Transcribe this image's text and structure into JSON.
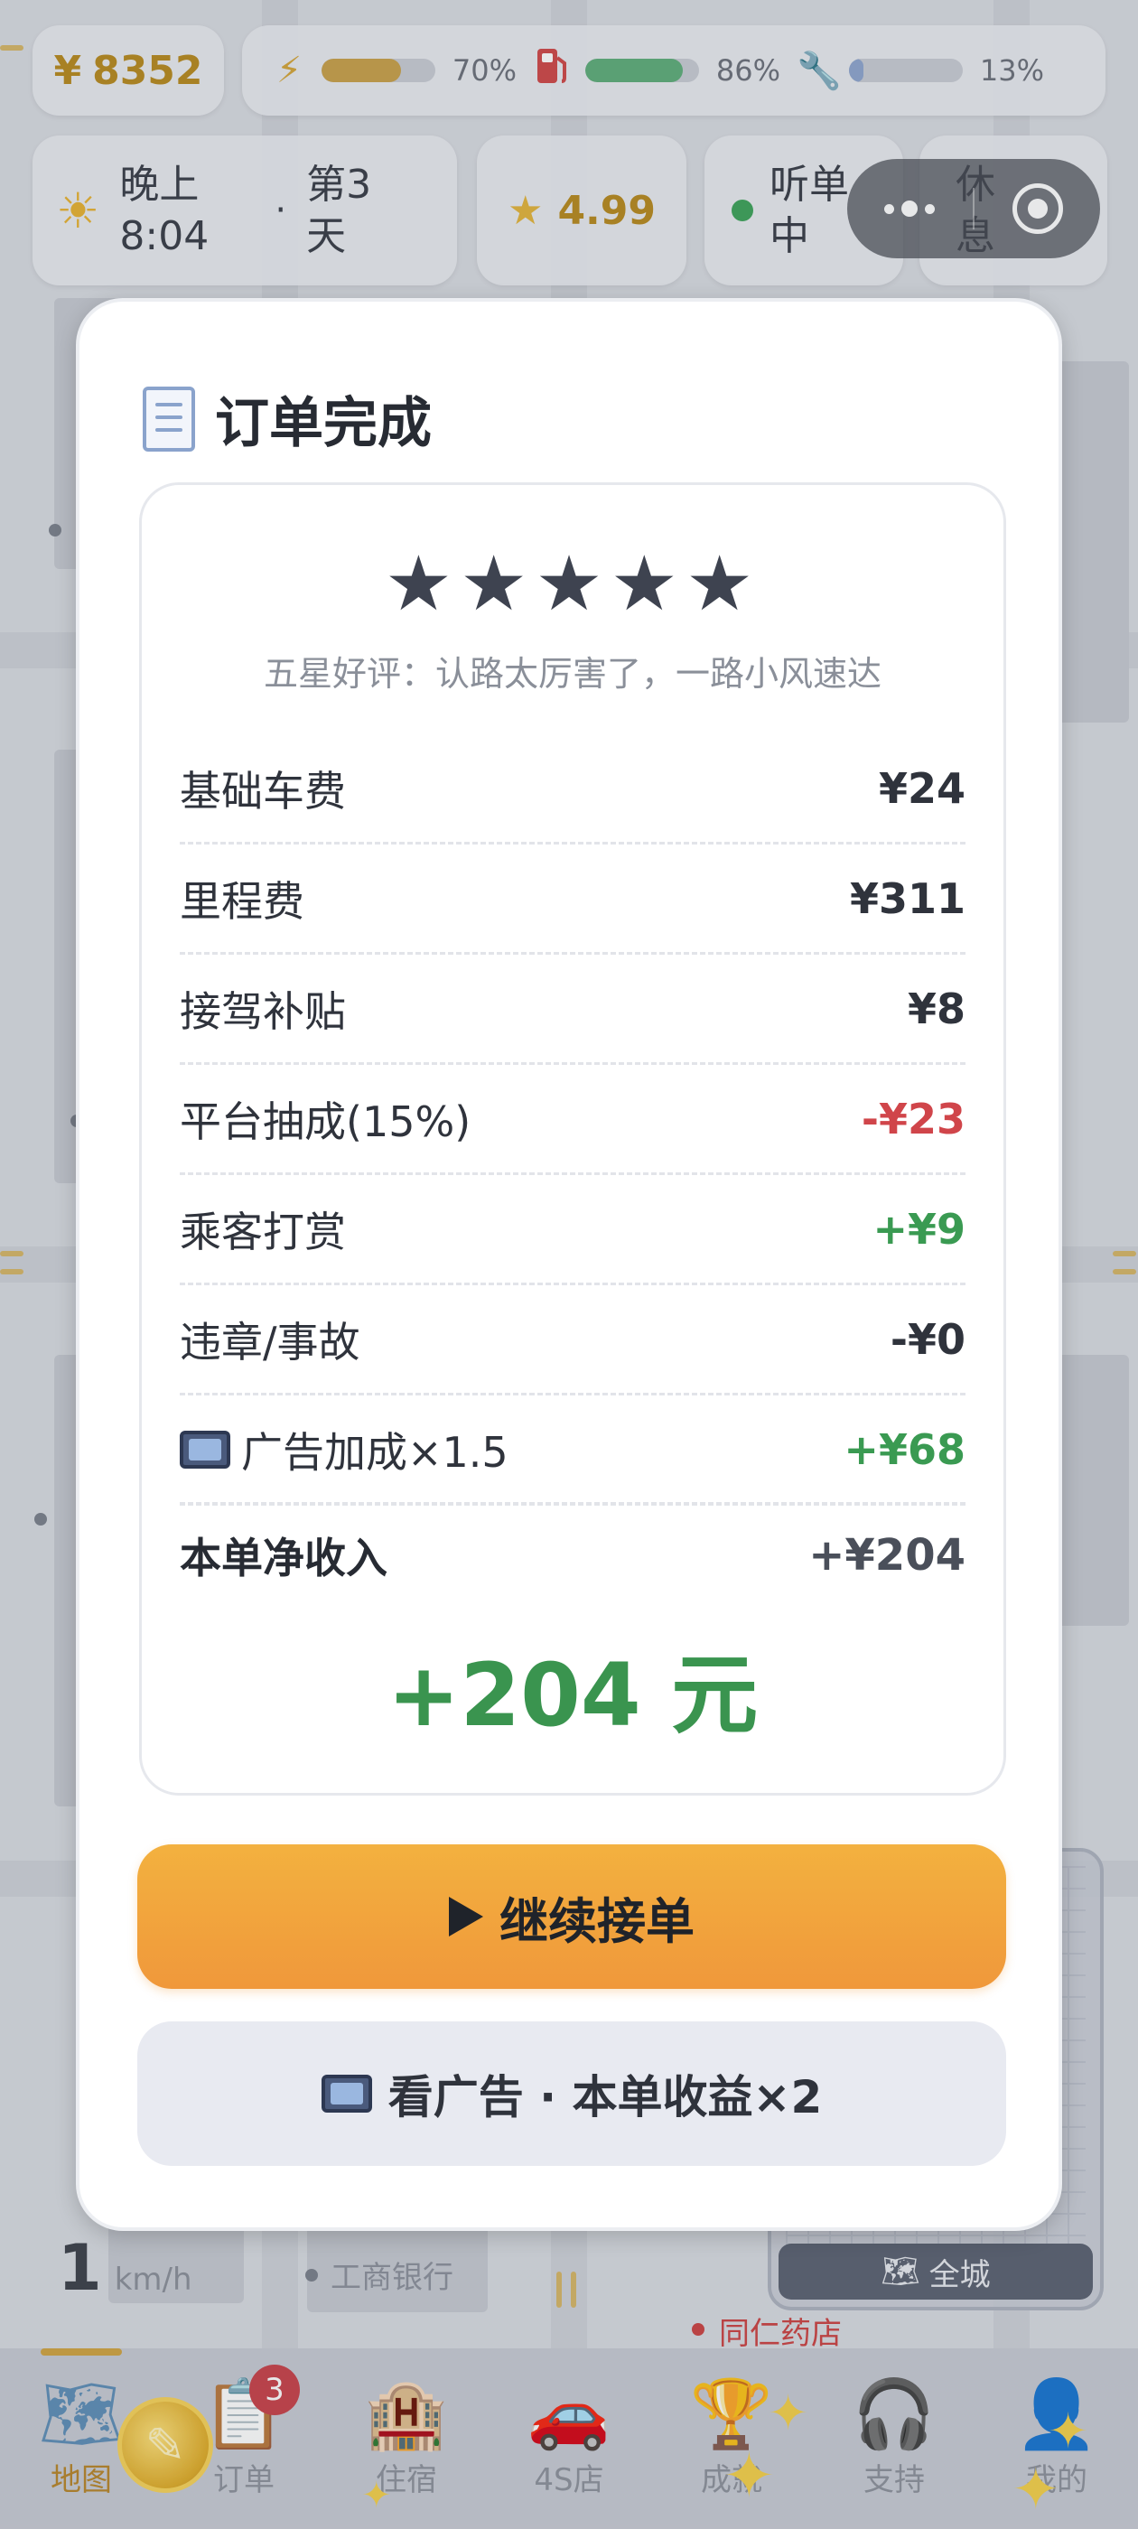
{
  "hud": {
    "money_symbol": "¥",
    "money_value": "8352",
    "energy": {
      "icon": "lightning-icon",
      "percent": "70%",
      "fill": 0.7,
      "color": "#c9a14a"
    },
    "fuel": {
      "icon": "fuel-pump-icon",
      "percent": "86%",
      "fill": 0.86,
      "color": "#5fae7a"
    },
    "wear": {
      "icon": "wrench-icon",
      "percent": "13%",
      "fill": 0.13,
      "color": "#8fa6cf"
    },
    "time_line1": "晚上",
    "time_line2": "8:04",
    "day_line1": "第3",
    "day_line2": "天",
    "rating": "4.99",
    "status_line1": "听单",
    "status_line2": "中",
    "rest_line1": "休",
    "rest_line2": "息"
  },
  "map": {
    "labels": [
      "工商银行",
      "同仁药店"
    ],
    "speed_value": "1",
    "speed_unit": "km/h",
    "minimap_label": "全城"
  },
  "tabs": [
    {
      "label": "地图",
      "icon": "map-icon",
      "active": true
    },
    {
      "label": "订单",
      "icon": "clipboard-icon",
      "badge": "3"
    },
    {
      "label": "住宿",
      "icon": "hotel-icon"
    },
    {
      "label": "4S店",
      "icon": "car-icon"
    },
    {
      "label": "成就",
      "icon": "trophy-icon"
    },
    {
      "label": "支持",
      "icon": "headphones-icon"
    },
    {
      "label": "我的",
      "icon": "user-icon"
    }
  ],
  "modal": {
    "title": "订单完成",
    "stars": "★★★★★",
    "review": "五星好评：认路太厉害了，一路小风速达",
    "rows": [
      {
        "label": "基础车费",
        "value": "¥24"
      },
      {
        "label": "里程费",
        "value": "¥311"
      },
      {
        "label": "接驾补贴",
        "value": "¥8"
      },
      {
        "label": "平台抽成(15%)",
        "value": "-¥23"
      },
      {
        "label": "乘客打赏",
        "value": "+¥9"
      },
      {
        "label": "违章/事故",
        "value": "-¥0"
      },
      {
        "label": "广告加成×1.5",
        "value": "+¥68"
      }
    ],
    "net_label": "本单净收入",
    "net_value": "+¥204",
    "total": "+204 元",
    "continue_label": "继续接单",
    "ad_label": "看广告 · 本单收益×2"
  },
  "colors": {
    "accent_gold": "#b88a1f",
    "positive": "#3a9a52",
    "negative": "#d0454a",
    "button_orange": "#f0983b"
  }
}
